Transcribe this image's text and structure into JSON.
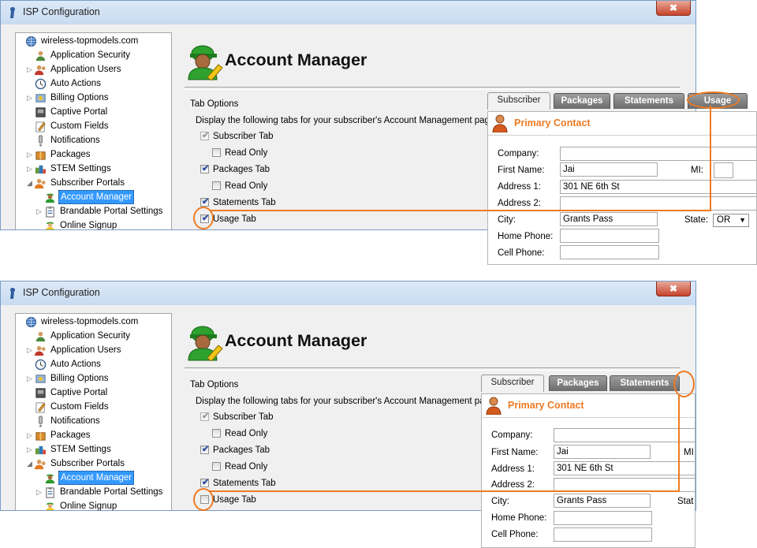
{
  "window": {
    "title": "ISP Configuration",
    "close_label": "✖"
  },
  "tree": {
    "items": [
      {
        "label": "wireless-topmodels.com",
        "icon": "globe-icon"
      },
      {
        "label": "Application Security",
        "icon": "users-key-icon"
      },
      {
        "label": "Application Users",
        "icon": "users-icon"
      },
      {
        "label": "Auto Actions",
        "icon": "clock-icon"
      },
      {
        "label": "Billing Options",
        "icon": "billing-icon"
      },
      {
        "label": "Captive Portal",
        "icon": "portal-icon"
      },
      {
        "label": "Custom Fields",
        "icon": "pencil-icon"
      },
      {
        "label": "Notifications",
        "icon": "exclamation-icon"
      },
      {
        "label": "Packages",
        "icon": "package-icon"
      },
      {
        "label": "STEM Settings",
        "icon": "stem-icon"
      },
      {
        "label": "Subscriber Portals",
        "icon": "subscribers-icon"
      },
      {
        "label": "Account Manager",
        "icon": "account-manager-icon"
      },
      {
        "label": "Brandable Portal Settings",
        "icon": "clipboard-icon"
      },
      {
        "label": "Online Signup",
        "icon": "signup-icon"
      }
    ]
  },
  "main": {
    "title": "Account Manager",
    "tab_options_label": "Tab Options",
    "description": "Display the following tabs for your subscriber's Account Management page:",
    "checks": {
      "subscriber_tab": "Subscriber Tab",
      "read_only": "Read Only",
      "packages_tab": "Packages Tab",
      "statements_tab": "Statements Tab",
      "usage_tab": "Usage Tab"
    },
    "check_mark": "✔"
  },
  "preview": {
    "tabs": [
      "Subscriber",
      "Packages",
      "Statements",
      "Usage"
    ],
    "primary_contact": "Primary Contact",
    "labels": {
      "company": "Company:",
      "first_name": "First Name:",
      "mi": "MI:",
      "mi_cut": "MI",
      "address1": "Address 1:",
      "address2": "Address 2:",
      "city": "City:",
      "state": "State:",
      "state_cut": "Stat",
      "home_phone": "Home Phone:",
      "cell_phone": "Cell Phone:"
    },
    "values": {
      "first_name": "Jai",
      "address1": "301 NE 6th St",
      "city": "Grants Pass",
      "state": "OR"
    },
    "select_arrow": "▼"
  },
  "states": [
    {
      "name": "usage-enabled",
      "usage_tab_checked": true
    },
    {
      "name": "usage-disabled",
      "usage_tab_checked": false
    }
  ],
  "colors": {
    "accent": "#ee7a22",
    "selection": "#3399ff",
    "tab_grey": "#7a7a7a"
  }
}
